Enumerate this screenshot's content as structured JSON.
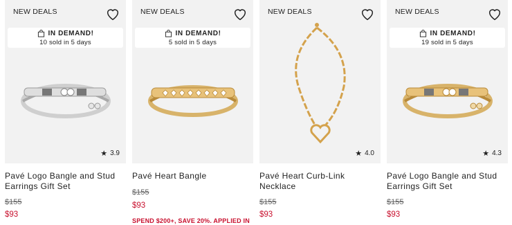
{
  "products": [
    {
      "badge": "NEW DEALS",
      "demand_title": "IN DEMAND!",
      "demand_sub": "10 sold in 5 days",
      "rating_star": "★",
      "rating": "3.9",
      "name": "Pavé Logo Bangle and Stud Earrings Gift Set",
      "original_price": "$155",
      "sale_price": "$93",
      "image_icon": "silver-bangle-earrings"
    },
    {
      "badge": "NEW DEALS",
      "demand_title": "IN DEMAND!",
      "demand_sub": "5 sold in 5 days",
      "name": "Pavé Heart Bangle",
      "original_price": "$155",
      "sale_price": "$93",
      "promo": "SPEND $200+, SAVE 20%. APPLIED IN",
      "image_icon": "gold-heart-bangle"
    },
    {
      "badge": "NEW DEALS",
      "rating_star": "★",
      "rating": "4.0",
      "name": "Pavé Heart Curb-Link Necklace",
      "original_price": "$155",
      "sale_price": "$93",
      "image_icon": "gold-heart-necklace"
    },
    {
      "badge": "NEW DEALS",
      "demand_title": "IN DEMAND!",
      "demand_sub": "19 sold in 5 days",
      "rating_star": "★",
      "rating": "4.3",
      "name": "Pavé Logo Bangle and Stud Earrings Gift Set",
      "original_price": "$155",
      "sale_price": "$93",
      "image_icon": "gold-bangle-earrings"
    }
  ],
  "colors": {
    "sale": "#c8102e",
    "image_bg": "#f2f2f2",
    "gold": "#d4a24c",
    "silver": "#c9c9c9"
  }
}
